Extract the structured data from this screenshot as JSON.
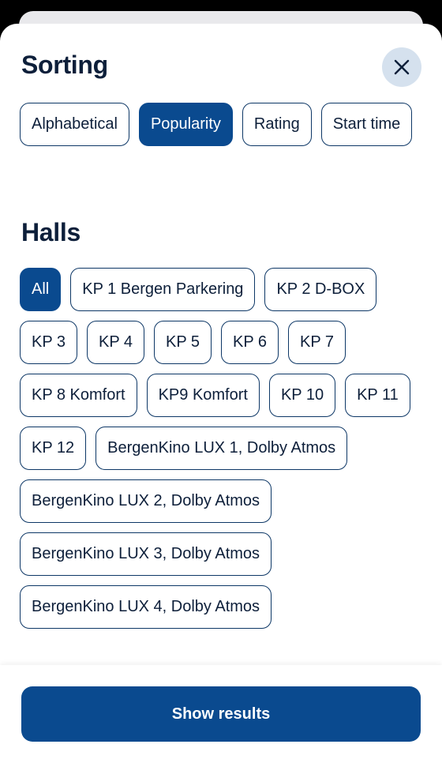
{
  "sorting": {
    "title": "Sorting",
    "options": [
      {
        "label": "Alphabetical",
        "selected": false
      },
      {
        "label": "Popularity",
        "selected": true
      },
      {
        "label": "Rating",
        "selected": false
      },
      {
        "label": "Start time",
        "selected": false
      }
    ]
  },
  "halls": {
    "title": "Halls",
    "options": [
      {
        "label": "All",
        "selected": true
      },
      {
        "label": "KP  1 Bergen Parkering",
        "selected": false
      },
      {
        "label": "KP 2 D-BOX",
        "selected": false
      },
      {
        "label": "KP 3",
        "selected": false
      },
      {
        "label": "KP 4",
        "selected": false
      },
      {
        "label": "KP 5",
        "selected": false
      },
      {
        "label": "KP 6",
        "selected": false
      },
      {
        "label": "KP 7",
        "selected": false
      },
      {
        "label": "KP 8 Komfort",
        "selected": false
      },
      {
        "label": "KP9 Komfort",
        "selected": false
      },
      {
        "label": "KP 10",
        "selected": false
      },
      {
        "label": "KP 11",
        "selected": false
      },
      {
        "label": "KP 12",
        "selected": false
      },
      {
        "label": "BergenKino LUX 1, Dolby Atmos",
        "selected": false
      },
      {
        "label": "BergenKino LUX 2, Dolby Atmos",
        "selected": false
      },
      {
        "label": "BergenKino LUX 3, Dolby Atmos",
        "selected": false
      },
      {
        "label": "BergenKino LUX 4, Dolby Atmos",
        "selected": false
      }
    ]
  },
  "footer": {
    "show_results_label": "Show results"
  },
  "colors": {
    "primary": "#0a4a8f",
    "text": "#0d1f3a",
    "close_bg": "#d5e1ee"
  }
}
